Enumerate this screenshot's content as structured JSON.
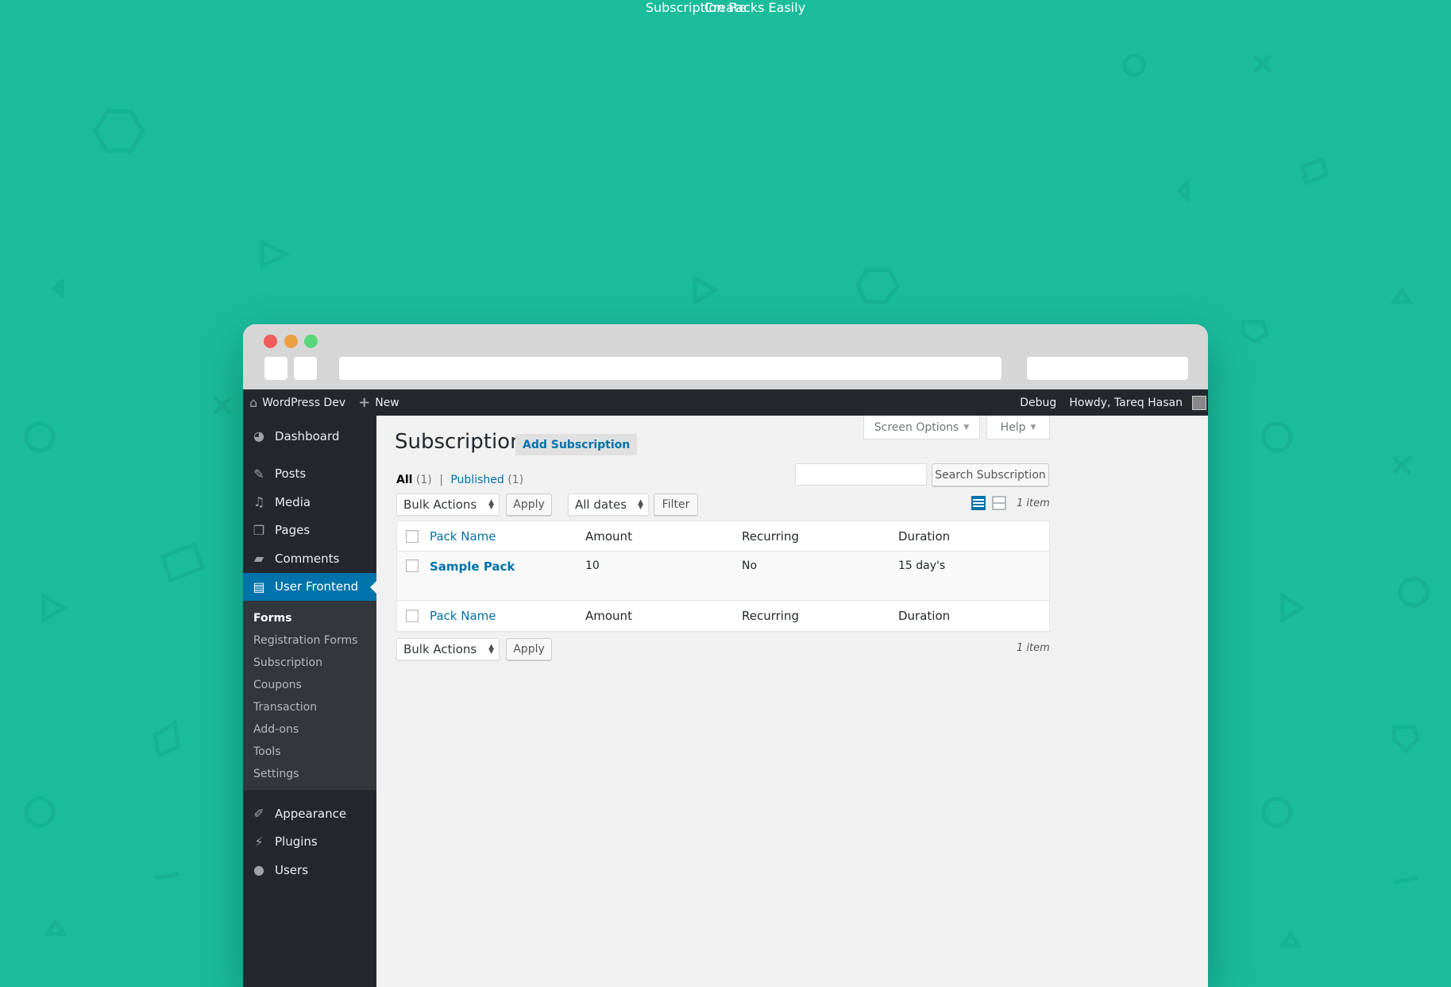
{
  "hero": {
    "line1": "Create",
    "line2": "Subscription Packs Easily"
  },
  "colors": {
    "background": "#1abc9c",
    "admin_bar": "#23282d",
    "sidebar_active": "#0073aa",
    "link": "#0073aa",
    "traffic_red": "#f05a5a",
    "traffic_orange": "#eba041",
    "traffic_green": "#5ad67a"
  },
  "admin_bar": {
    "site_icon": "home-icon",
    "site_name": "WordPress Dev",
    "new_icon": "plus-icon",
    "new_label": "New",
    "debug_label": "Debug",
    "howdy_label": "Howdy, Tareq Hasan"
  },
  "sidebar": {
    "items": [
      {
        "icon": "dashboard-icon",
        "label": "Dashboard"
      },
      {
        "icon": "pin-icon",
        "label": "Posts"
      },
      {
        "icon": "media-icon",
        "label": "Media"
      },
      {
        "icon": "pages-icon",
        "label": "Pages"
      },
      {
        "icon": "comment-icon",
        "label": "Comments"
      },
      {
        "icon": "layout-icon",
        "label": "User Frontend",
        "active": true
      }
    ],
    "submenu": [
      {
        "label": "Forms",
        "current": true
      },
      {
        "label": "Registration Forms"
      },
      {
        "label": "Subscription"
      },
      {
        "label": "Coupons"
      },
      {
        "label": "Transaction"
      },
      {
        "label": "Add-ons"
      },
      {
        "label": "Tools"
      },
      {
        "label": "Settings"
      }
    ],
    "items_after": [
      {
        "icon": "brush-icon",
        "label": "Appearance"
      },
      {
        "icon": "plug-icon",
        "label": "Plugins"
      },
      {
        "icon": "user-icon",
        "label": "Users"
      }
    ]
  },
  "screen_meta": {
    "screen_options": "Screen Options",
    "help": "Help"
  },
  "page": {
    "title": "Subscription",
    "add_button": "Add Subscription",
    "filters": {
      "all_label": "All",
      "all_count": "(1)",
      "separator": "|",
      "published_label": "Published",
      "published_count": "(1)"
    },
    "search": {
      "value": "",
      "button": "Search Subscription"
    },
    "bulk_actions": "Bulk Actions",
    "apply": "Apply",
    "all_dates": "All dates",
    "filter": "Filter",
    "item_count": "1 item",
    "view_icons": [
      "list-view-icon",
      "excerpt-view-icon"
    ]
  },
  "table": {
    "columns": [
      "Pack Name",
      "Amount",
      "Recurring",
      "Duration"
    ],
    "rows": [
      {
        "pack_name": "Sample Pack",
        "amount": "10",
        "recurring": "No",
        "duration": "15 day's"
      }
    ]
  }
}
